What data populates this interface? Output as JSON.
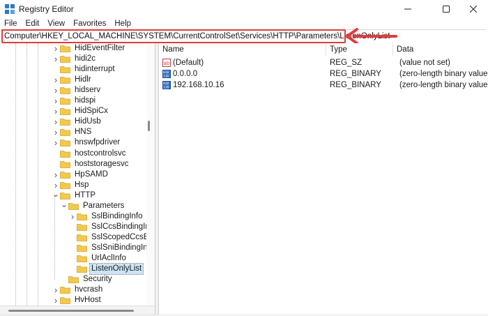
{
  "window": {
    "title": "Registry Editor",
    "minimize_glyph": "—",
    "maximize_glyph": "☐",
    "close_glyph": "✕"
  },
  "menu": [
    "File",
    "Edit",
    "View",
    "Favorites",
    "Help"
  ],
  "address": {
    "path": "Computer\\HKEY_LOCAL_MACHINE\\SYSTEM\\CurrentControlSet\\Services\\HTTP\\Parameters\\ListenOnlyList"
  },
  "annotation": {
    "color": "#e23b3b"
  },
  "tree": {
    "items": [
      {
        "label": "HidEventFilter",
        "depth": 0,
        "expander": "collapsed"
      },
      {
        "label": "hidi2c",
        "depth": 0,
        "expander": "collapsed"
      },
      {
        "label": "hidinterrupt",
        "depth": 0,
        "expander": "none"
      },
      {
        "label": "Hidlr",
        "depth": 0,
        "expander": "collapsed"
      },
      {
        "label": "hidserv",
        "depth": 0,
        "expander": "collapsed"
      },
      {
        "label": "hidspi",
        "depth": 0,
        "expander": "collapsed"
      },
      {
        "label": "HidSpiCx",
        "depth": 0,
        "expander": "collapsed"
      },
      {
        "label": "HidUsb",
        "depth": 0,
        "expander": "collapsed"
      },
      {
        "label": "HNS",
        "depth": 0,
        "expander": "collapsed"
      },
      {
        "label": "hnswfpdriver",
        "depth": 0,
        "expander": "collapsed"
      },
      {
        "label": "hostcontrolsvc",
        "depth": 0,
        "expander": "none"
      },
      {
        "label": "hoststoragesvc",
        "depth": 0,
        "expander": "none"
      },
      {
        "label": "HpSAMD",
        "depth": 0,
        "expander": "collapsed"
      },
      {
        "label": "Hsp",
        "depth": 0,
        "expander": "collapsed"
      },
      {
        "label": "HTTP",
        "depth": 0,
        "expander": "expanded"
      },
      {
        "label": "Parameters",
        "depth": 1,
        "expander": "expanded"
      },
      {
        "label": "SslBindingInfo",
        "depth": 2,
        "expander": "collapsed"
      },
      {
        "label": "SslCcsBindingInfo",
        "depth": 2,
        "expander": "none"
      },
      {
        "label": "SslScopedCcsBind",
        "depth": 2,
        "expander": "none"
      },
      {
        "label": "SslSniBindingInfo",
        "depth": 2,
        "expander": "none"
      },
      {
        "label": "UrlAclInfo",
        "depth": 2,
        "expander": "none"
      },
      {
        "label": "ListenOnlyList",
        "depth": 2,
        "expander": "none",
        "selected": true
      },
      {
        "label": "Security",
        "depth": 1,
        "expander": "none"
      },
      {
        "label": "hvcrash",
        "depth": 0,
        "expander": "collapsed"
      },
      {
        "label": "HvHost",
        "depth": 0,
        "expander": "collapsed"
      }
    ]
  },
  "list": {
    "columns": [
      "Name",
      "Type",
      "Data"
    ],
    "rows": [
      {
        "name": "(Default)",
        "type": "REG_SZ",
        "data": "(value not set)",
        "icon": "string-value-icon"
      },
      {
        "name": "0.0.0.0",
        "type": "REG_BINARY",
        "data": "(zero-length binary value)",
        "icon": "binary-value-icon"
      },
      {
        "name": "192.168.10.16",
        "type": "REG_BINARY",
        "data": "(zero-length binary value)",
        "icon": "binary-value-icon"
      }
    ]
  },
  "colors": {
    "folder": "#f2c94c",
    "folder_dark": "#d9a526",
    "selection": "#cce4f7",
    "highlight": "#e23b3b"
  }
}
